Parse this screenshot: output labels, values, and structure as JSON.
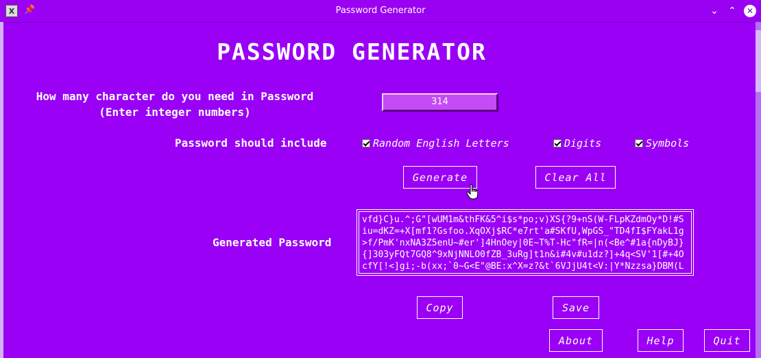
{
  "window": {
    "title": "Password Generator",
    "app_icon_glyph": "X"
  },
  "heading": "PASSWORD GENERATOR",
  "length": {
    "label_line1": "How many character do you need in Password",
    "label_line2": "(Enter integer numbers)",
    "value": "314"
  },
  "include": {
    "label": "Password should include",
    "options": [
      {
        "label": "Random English Letters",
        "checked": true
      },
      {
        "label": "Digits",
        "checked": true
      },
      {
        "label": "Symbols",
        "checked": true
      }
    ]
  },
  "buttons": {
    "generate": "Generate",
    "clear_all": "Clear All",
    "copy": "Copy",
    "save": "Save",
    "about": "About",
    "help": "Help",
    "quit": "Quit"
  },
  "output": {
    "label": "Generated Password",
    "lines": [
      "vfd}C}u.^;G\"[wUM1m&thFK&5^i$s*po;v)XS{?9+nS(W-FLpKZdmOy*D!#S",
      "iu=dKZ=+X[mf1?Gsfoo.XqOXj$RC*e7rt'a#SKfU,WpGS_\"TD4fI$FYakL1g",
      ">f/PmK'nxNA3Z5enU~#er']4HnOey|0E~T%T-Hc\"fR=|n(<Be^#1a{nDyBJ}",
      "{]303yFQt7GQ8^9xNjNNLO0fZB_3uRg]t1n&i#4v#u1dz?]+4q<SV'1[#+4O",
      "cfY[!<]gi;-b(xx;`0~G<E\"@BE:x^X=z?&t`6VJjU4t<V:|Y*Nzzsa}DBM(L"
    ]
  },
  "colors": {
    "background": "#9900f5",
    "entry_background": "#c34cf5",
    "text": "#ffffff"
  }
}
